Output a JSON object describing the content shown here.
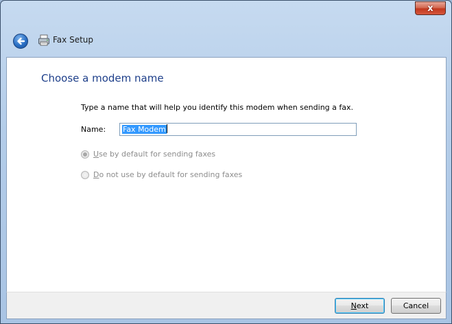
{
  "window": {
    "title": "Fax Setup",
    "close_label": "x"
  },
  "page": {
    "heading": "Choose a modem name",
    "instruction": "Type a name that will help you identify this modem when sending a fax.",
    "name_label": "Name:",
    "name_value": "Fax Modem"
  },
  "options": [
    {
      "access_key": "U",
      "rest": "se by default for sending faxes",
      "selected": true,
      "enabled": false
    },
    {
      "access_key": "D",
      "rest": "o not use by default for sending faxes",
      "selected": false,
      "enabled": false
    }
  ],
  "buttons": {
    "next_key": "N",
    "next_rest": "ext",
    "cancel": "Cancel"
  },
  "colors": {
    "heading": "#1e3f8a",
    "selection": "#3399ff",
    "close": "#c2381e"
  },
  "icons": [
    "back-arrow-icon",
    "fax-icon",
    "close-icon"
  ]
}
